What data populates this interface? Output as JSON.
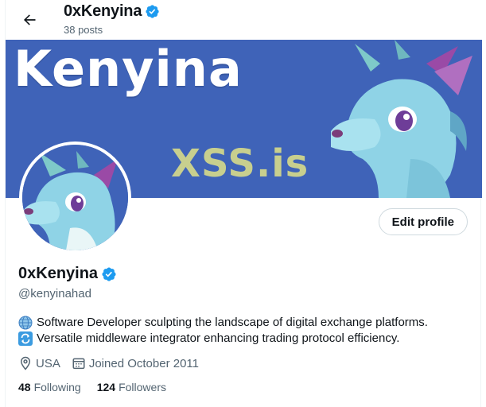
{
  "header": {
    "name": "0xKenyina",
    "posts": "38 posts"
  },
  "banner": {
    "title": "Kenyina",
    "subtitle": "XSS.is"
  },
  "profile": {
    "name": "0xKenyina",
    "handle": "@kenyinahad",
    "edit_label": "Edit profile",
    "bio": [
      {
        "icon": "globe-icon",
        "text": "Software Developer sculpting the landscape of digital exchange platforms."
      },
      {
        "icon": "refresh-icon",
        "text": "Versatile middleware integrator enhancing trading protocol efficiency."
      }
    ],
    "location": "USA",
    "joined": "Joined October 2011",
    "following_count": "48",
    "following_label": "Following",
    "followers_count": "124",
    "followers_label": "Followers"
  },
  "colors": {
    "verified": "#1d9bf0",
    "banner_bg": "#3f63b8",
    "muted_text": "#536471"
  }
}
